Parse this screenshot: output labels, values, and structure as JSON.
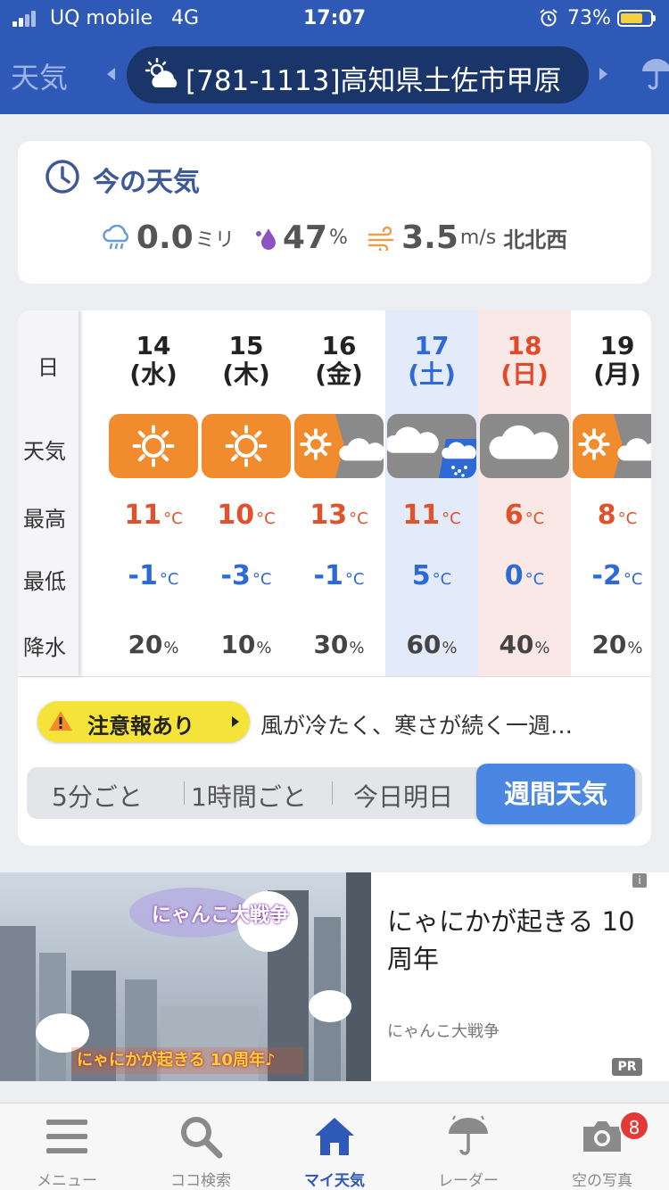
{
  "status_bar": {
    "carrier": "UQ mobile",
    "network": "4G",
    "time": "17:07",
    "battery_percent": "73%"
  },
  "nav": {
    "left_label": "天気",
    "location": "[781-1113]高知県土佐市甲原",
    "location_icon": "partly-sunny-icon"
  },
  "now": {
    "title": "今の天気",
    "rain_value": "0.0",
    "rain_unit": "ミリ",
    "humidity_value": "47",
    "humidity_unit": "%",
    "wind_value": "3.5",
    "wind_unit": "m/s",
    "wind_dir": "北北西"
  },
  "week": {
    "labels": {
      "day": "日",
      "weather": "天気",
      "high": "最高",
      "low": "最低",
      "rain": "降水"
    },
    "days": [
      {
        "date": "14",
        "weekday": "(水)",
        "weather": "sunny",
        "high": "11",
        "low": "-1",
        "rain": "20"
      },
      {
        "date": "15",
        "weekday": "(木)",
        "weather": "sunny",
        "high": "10",
        "low": "-3",
        "rain": "10"
      },
      {
        "date": "16",
        "weekday": "(金)",
        "weather": "sunny-then-cloudy",
        "high": "13",
        "low": "-1",
        "rain": "30"
      },
      {
        "date": "17",
        "weekday": "(土)",
        "weather": "cloudy-then-rain",
        "high": "11",
        "low": "5",
        "rain": "60"
      },
      {
        "date": "18",
        "weekday": "(日)",
        "weather": "cloudy",
        "high": "6",
        "low": "0",
        "rain": "40"
      },
      {
        "date": "19",
        "weekday": "(月)",
        "weather": "sunny-then-cloudy",
        "high": "8",
        "low": "-2",
        "rain": "20"
      }
    ],
    "temp_unit": "°C",
    "rain_unit": "%",
    "alert_label": "注意報あり",
    "alert_text": "風が冷たく、寒さが続く一週…",
    "tabs": [
      "5分ごと",
      "1時間ごと",
      "今日明日",
      "週間天気"
    ],
    "active_tab": "週間天気"
  },
  "ad": {
    "headline": "にゃにかが起きる 10周年",
    "source": "にゃんこ大戦争",
    "image_caption": "にゃにかが起きる 10周年♪",
    "pr": "PR",
    "info": "i"
  },
  "tabbar": {
    "items": [
      {
        "label": "メニュー",
        "icon": "menu-icon"
      },
      {
        "label": "ココ検索",
        "icon": "search-icon"
      },
      {
        "label": "マイ天気",
        "icon": "home-icon"
      },
      {
        "label": "レーダー",
        "icon": "umbrella-icon"
      },
      {
        "label": "空の写真",
        "icon": "camera-icon"
      }
    ],
    "active": "マイ天気",
    "photo_badge": "8"
  },
  "colors": {
    "brand_blue": "#2f59b6",
    "sunny_orange": "#f08c2e",
    "cloudy_gray": "#8a8a8a",
    "high_temp": "#e0522c",
    "low_temp": "#2d6ad6",
    "saturday_bg": "#e3ebfb",
    "sunday_bg": "#f9e8e6"
  }
}
